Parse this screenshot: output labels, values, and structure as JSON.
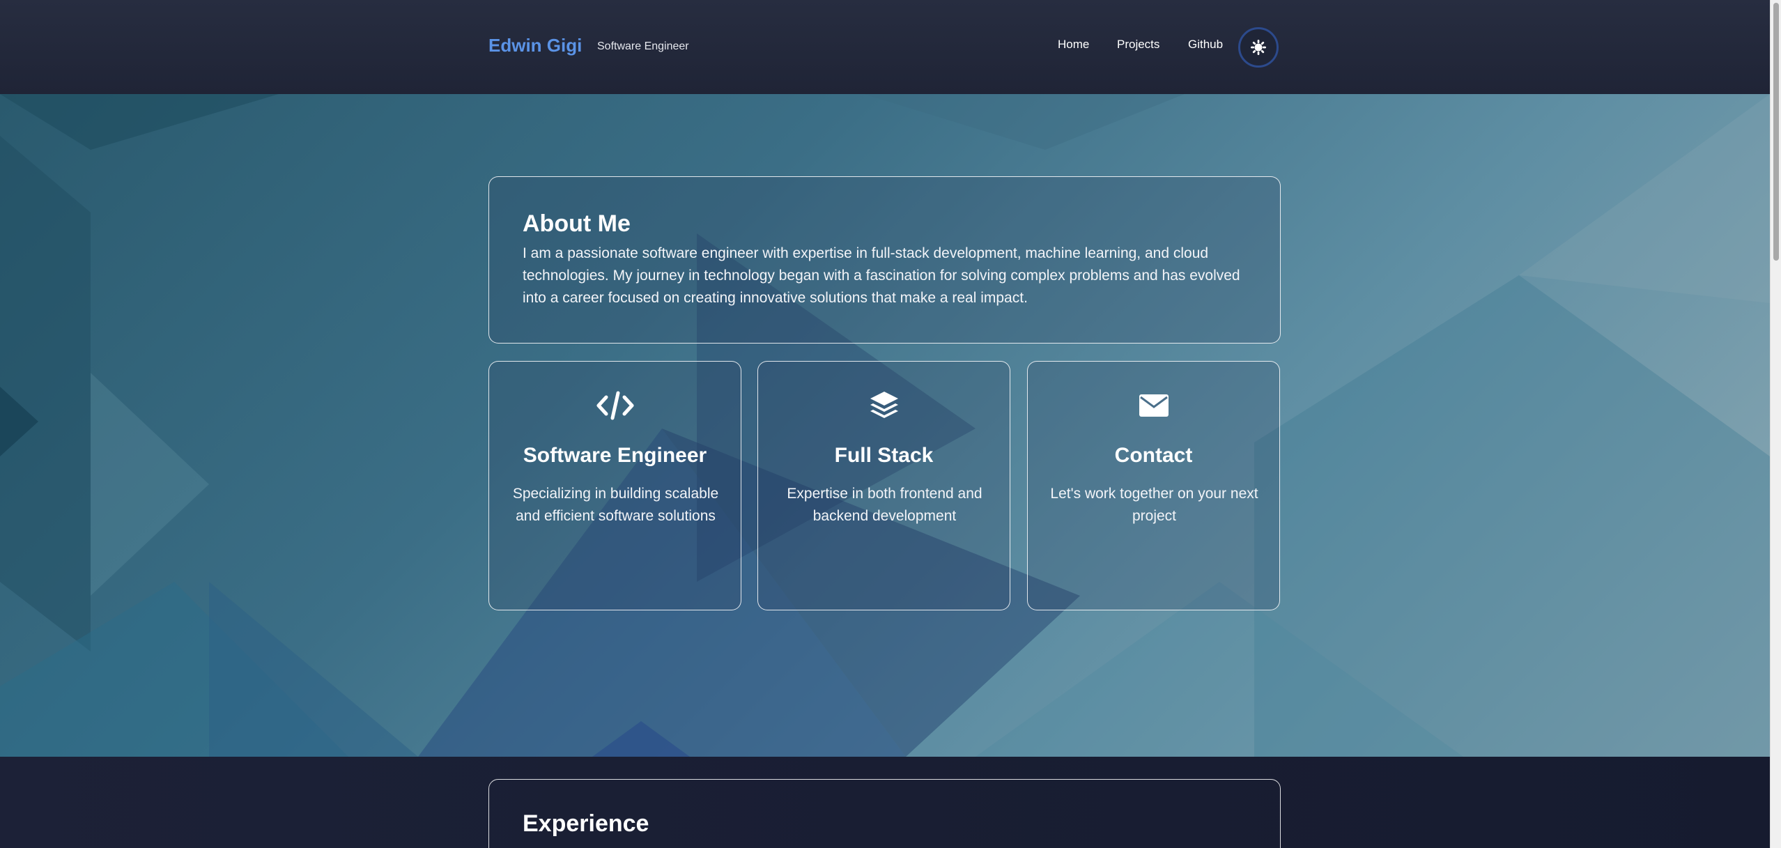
{
  "header": {
    "brand": "Edwin Gigi",
    "tagline": "Software Engineer",
    "nav": [
      "Home",
      "Projects",
      "Github"
    ],
    "theme_toggle_icon": "sun-icon"
  },
  "about": {
    "title": "About Me",
    "text": "I am a passionate software engineer with expertise in full-stack development, machine learning, and cloud technologies. My journey in technology began with a fascination for solving complex problems and has evolved into a career focused on creating innovative solutions that make a real impact."
  },
  "features": [
    {
      "icon": "code-icon",
      "title": "Software Engineer",
      "description": "Specializing in building scalable and efficient software solutions"
    },
    {
      "icon": "layers-icon",
      "title": "Full Stack",
      "description": "Expertise in both frontend and backend development"
    },
    {
      "icon": "envelope-icon",
      "title": "Contact",
      "description": "Let's work together on your next project"
    }
  ],
  "experience": {
    "title": "Experience"
  },
  "colors": {
    "brand": "#5b93e6",
    "header_bg": "#232939",
    "toggle_ring": "#2c4a8c"
  }
}
